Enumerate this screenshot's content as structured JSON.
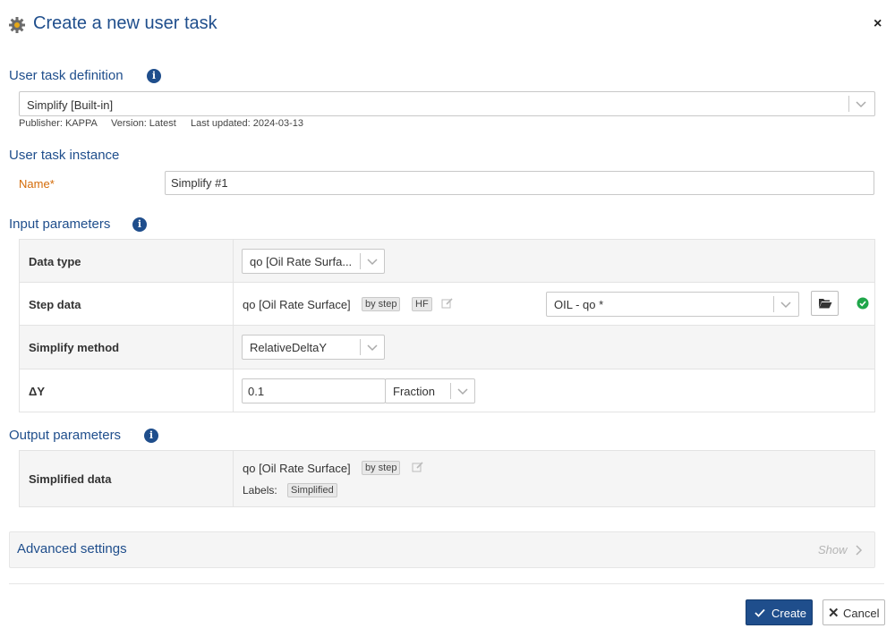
{
  "dialog": {
    "title": "Create a new user task",
    "close_label": "×"
  },
  "definition": {
    "section_title": "User task definition",
    "selected": "Simplify [Built-in]",
    "publisher": "Publisher: KAPPA",
    "version": "Version: Latest",
    "last_updated": "Last updated: 2024-03-13"
  },
  "instance": {
    "section_title": "User task instance",
    "name_label": "Name",
    "required_mark": "*",
    "name_value": "Simplify #1"
  },
  "input_params": {
    "section_title": "Input parameters",
    "rows": {
      "data_type": {
        "label": "Data type",
        "value": "qo [Oil Rate Surfa..."
      },
      "step_data": {
        "label": "Step data",
        "value": "qo [Oil Rate Surface]",
        "tag_mode": "by step",
        "tag_freq": "HF",
        "source": "OIL - qo *"
      },
      "method": {
        "label": "Simplify method",
        "value": "RelativeDeltaY"
      },
      "delta_y": {
        "label": "ΔY",
        "value": "0.1",
        "unit": "Fraction"
      }
    }
  },
  "output_params": {
    "section_title": "Output parameters",
    "rows": {
      "simplified": {
        "label": "Simplified data",
        "value": "qo [Oil Rate Surface]",
        "tag_mode": "by step",
        "labels_label": "Labels:",
        "label_tag": "Simplified"
      }
    }
  },
  "advanced": {
    "title": "Advanced settings",
    "toggle": "Show"
  },
  "footer": {
    "create_label": "Create",
    "cancel_label": "Cancel"
  },
  "colors": {
    "accent": "#1f4e8c",
    "required": "#d46b08",
    "success": "#1fa64a"
  }
}
